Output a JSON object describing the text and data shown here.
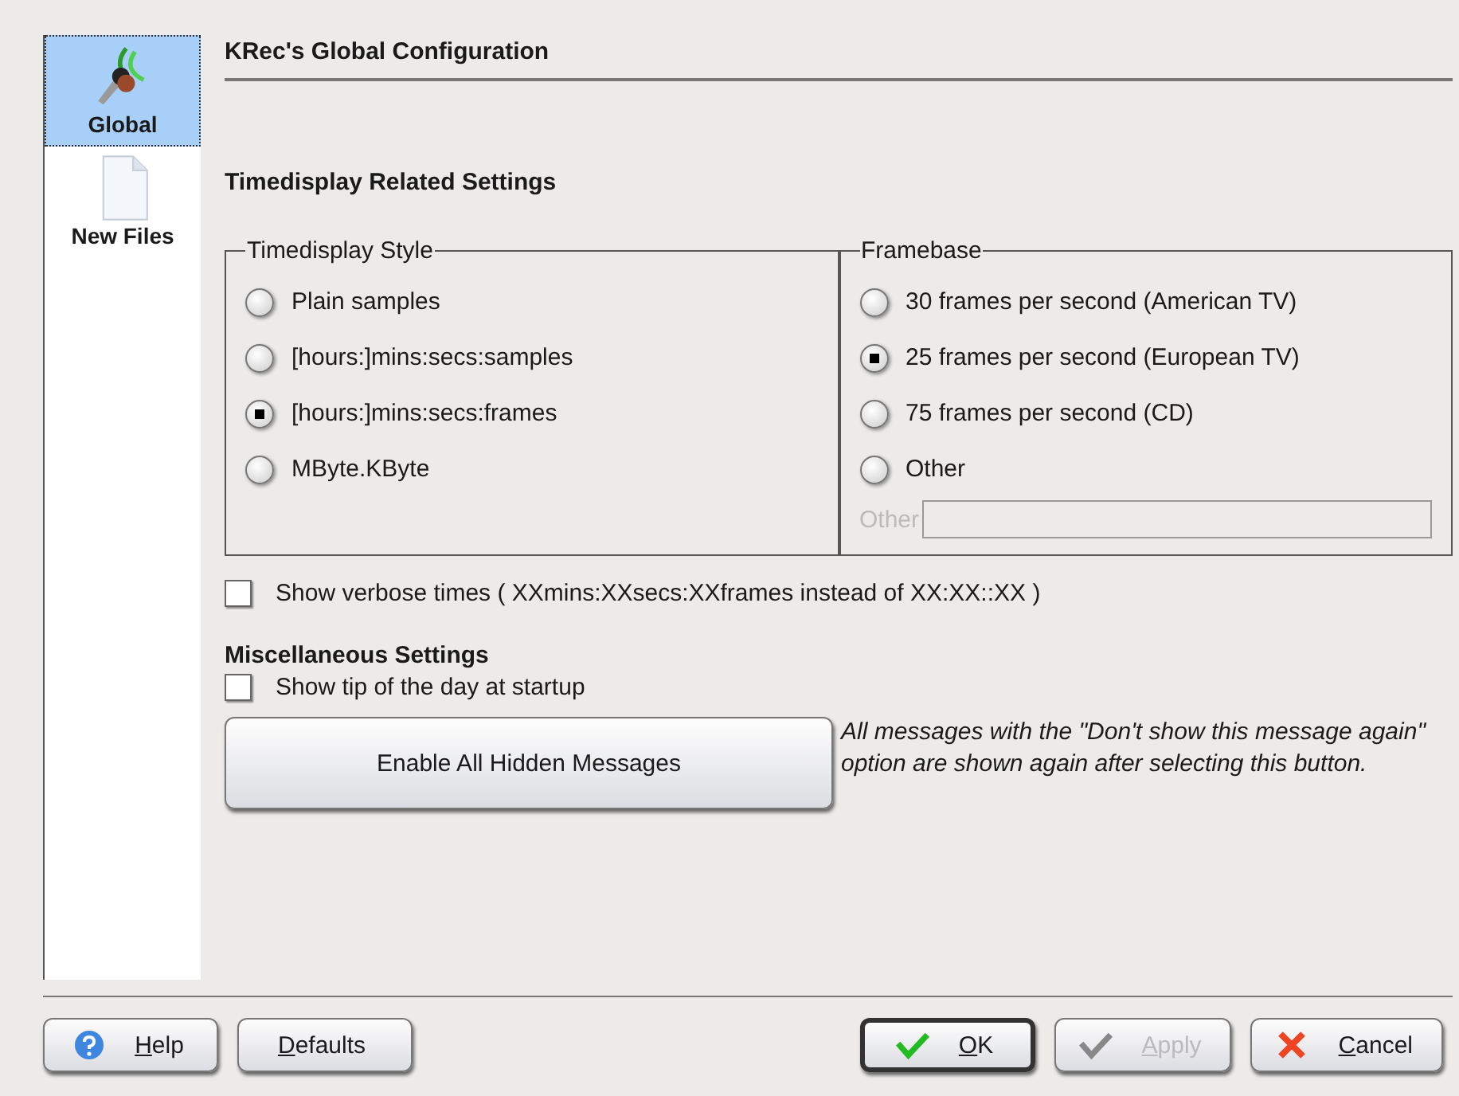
{
  "sidebar": {
    "items": [
      {
        "label": "Global",
        "kind": "microphone",
        "selected": true
      },
      {
        "label": "New Files",
        "kind": "document",
        "selected": false
      }
    ]
  },
  "page_title": "KRec's Global Configuration",
  "section_title": "Timedisplay Related Settings",
  "timedisplay_style": {
    "title": "Timedisplay Style",
    "options": [
      {
        "label": "Plain samples",
        "selected": false
      },
      {
        "label": "[hours:]mins:secs:samples",
        "selected": false
      },
      {
        "label": "[hours:]mins:secs:frames",
        "selected": true
      },
      {
        "label": "MByte.KByte",
        "selected": false
      }
    ]
  },
  "framebase": {
    "title": "Framebase",
    "options": [
      {
        "label": "30 frames per second (American TV)",
        "selected": false
      },
      {
        "label": "25 frames per second (European TV)",
        "selected": true
      },
      {
        "label": "75 frames per second (CD)",
        "selected": false
      },
      {
        "label": "Other",
        "selected": false
      }
    ],
    "other_field": {
      "label": "Other",
      "disabled": true
    }
  },
  "verbose_times": {
    "label": "Show verbose times ( XXmins:XXsecs:XXframes instead of XX:XX::XX )",
    "checked": false
  },
  "misc_title": "Miscellaneous Settings",
  "tip_of_day": {
    "label": "Show tip of the day at startup",
    "checked": false
  },
  "enable_button": "Enable All Hidden Messages",
  "enable_note": "All messages with the \"Don't show this message again\" option are shown again after selecting this button.",
  "buttons": [
    {
      "label": "Help",
      "kind": "help",
      "disabled": false,
      "default": false
    },
    {
      "label": "Defaults",
      "kind": "plain",
      "disabled": false,
      "default": false
    },
    {
      "label": "OK",
      "kind": "accept",
      "disabled": false,
      "default": true
    },
    {
      "label": "Apply",
      "kind": "accept",
      "disabled": true,
      "default": false
    },
    {
      "label": "Cancel",
      "kind": "cancel",
      "disabled": false,
      "default": false
    }
  ]
}
